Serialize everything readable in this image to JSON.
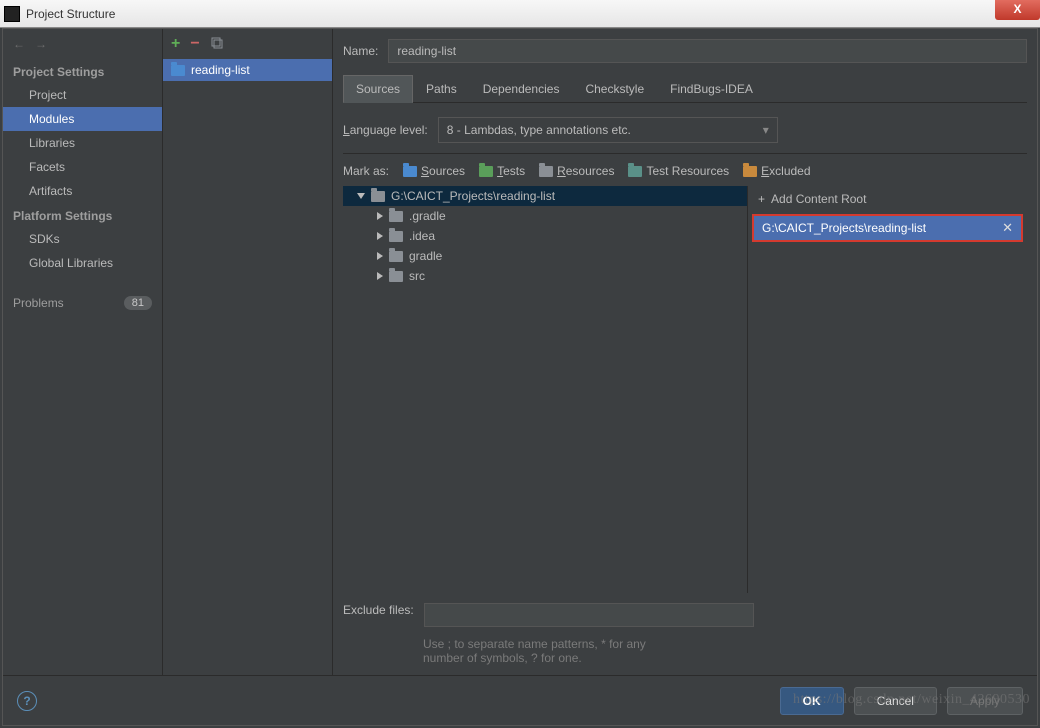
{
  "window": {
    "title": "Project Structure"
  },
  "sidebar": {
    "sections": [
      {
        "title": "Project Settings",
        "items": [
          "Project",
          "Modules",
          "Libraries",
          "Facets",
          "Artifacts"
        ],
        "selected": 1
      },
      {
        "title": "Platform Settings",
        "items": [
          "SDKs",
          "Global Libraries"
        ]
      }
    ],
    "problems_label": "Problems",
    "problems_count": "81"
  },
  "modules": {
    "items": [
      "reading-list"
    ]
  },
  "main": {
    "name_label": "Name:",
    "name_value": "reading-list",
    "tabs": [
      "Sources",
      "Paths",
      "Dependencies",
      "Checkstyle",
      "FindBugs-IDEA"
    ],
    "active_tab": 0,
    "lang_label": "Language level:",
    "lang_value": "8 - Lambdas, type annotations etc.",
    "mark_label": "Mark as:",
    "marks": [
      {
        "label": "Sources",
        "color": "fi-blue"
      },
      {
        "label": "Tests",
        "color": "fi-green"
      },
      {
        "label": "Resources",
        "color": "fi-gray"
      },
      {
        "label": "Test Resources",
        "color": "fi-teal"
      },
      {
        "label": "Excluded",
        "color": "fi-orange"
      }
    ],
    "tree": {
      "root": "G:\\CAICT_Projects\\reading-list",
      "children": [
        ".gradle",
        ".idea",
        "gradle",
        "src"
      ]
    },
    "add_content_root": "Add Content Root",
    "content_root": "G:\\CAICT_Projects\\reading-list",
    "exclude_label": "Exclude files:",
    "exclude_value": "",
    "exclude_hint": "Use ; to separate name patterns, * for any number of symbols, ? for one."
  },
  "buttons": {
    "ok": "OK",
    "cancel": "Cancel",
    "apply": "Apply"
  },
  "watermark": "https://blog.csdn.net/weixin_42690530"
}
